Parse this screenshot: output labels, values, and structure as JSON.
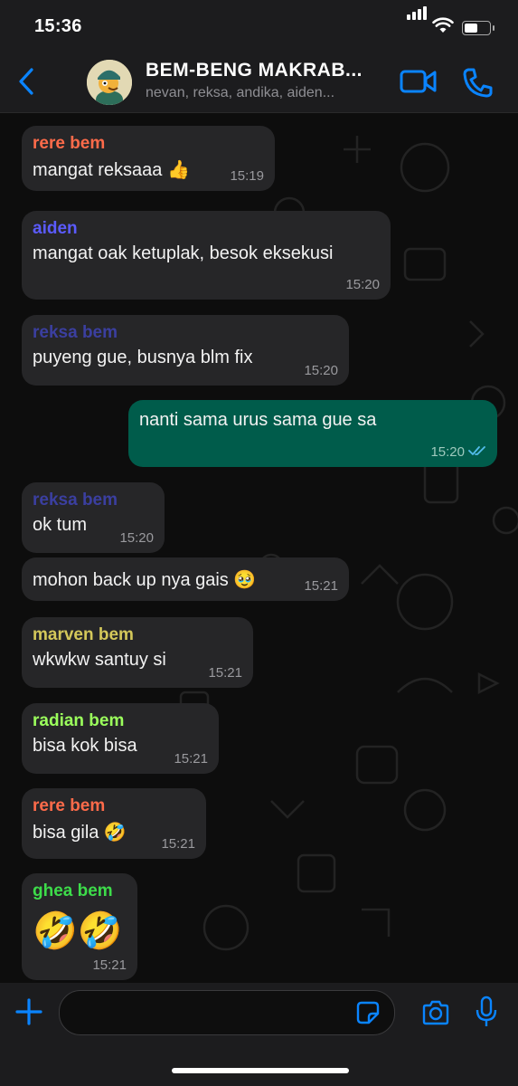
{
  "status_bar": {
    "time": "15:36",
    "battery_level": 0.55
  },
  "header": {
    "title": "BEM-BENG MAKRAB...",
    "subtitle": "nevan, reksa, andika, aiden...",
    "icons": [
      "back-chevron-icon",
      "avatar",
      "video-call-icon",
      "phone-call-icon"
    ]
  },
  "messages": [
    {
      "sender": "rere bem",
      "sender_color": "#ff6b4a",
      "text": "mangat reksaaa 👍",
      "time": "15:19",
      "direction": "in"
    },
    {
      "sender": "aiden",
      "sender_color": "#5b5bff",
      "text": "mangat oak ketuplak, besok eksekusi",
      "time": "15:20",
      "direction": "in"
    },
    {
      "sender": "reksa bem",
      "sender_color": "#3b3fa0",
      "text": "puyeng gue, busnya blm fix",
      "time": "15:20",
      "direction": "in"
    },
    {
      "text": "nanti sama urus sama gue sa",
      "time": "15:20",
      "direction": "out",
      "status": "read"
    },
    {
      "sender": "reksa bem",
      "sender_color": "#3b3fa0",
      "text": "ok tum",
      "time": "15:20",
      "direction": "in"
    },
    {
      "text": "mohon back up nya gais 🥹",
      "time": "15:21",
      "direction": "in"
    },
    {
      "sender": "marven bem",
      "sender_color": "#d4c85a",
      "text": "wkwkw santuy si",
      "time": "15:21",
      "direction": "in"
    },
    {
      "sender": "radian bem",
      "sender_color": "#9bff5c",
      "text": "bisa kok bisa",
      "time": "15:21",
      "direction": "in"
    },
    {
      "sender": "rere bem",
      "sender_color": "#ff6b4a",
      "text": "bisa gila 🤣",
      "time": "15:21",
      "direction": "in"
    },
    {
      "sender": "ghea bem",
      "sender_color": "#3ddc4a",
      "text": "🤣🤣",
      "time": "15:21",
      "direction": "in"
    }
  ],
  "input": {
    "placeholder": ""
  },
  "colors": {
    "incoming_bubble": "#262628",
    "outgoing_bubble": "#005c4b",
    "accent": "#0a84ff",
    "read_ticks": "#53bdeb"
  }
}
